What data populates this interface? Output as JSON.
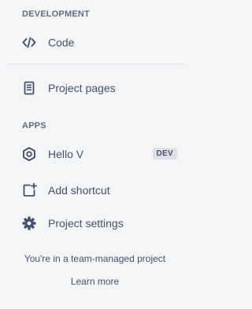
{
  "sections": {
    "development_heading": "DEVELOPMENT",
    "apps_heading": "APPS"
  },
  "nav": {
    "code": "Code",
    "project_pages": "Project pages",
    "hello_v": "Hello V",
    "hello_v_badge": "DEV",
    "add_shortcut": "Add shortcut",
    "project_settings": "Project settings"
  },
  "footer": {
    "note": "You're in a team-managed project",
    "learn_more": "Learn more"
  },
  "icons": {
    "code": "code-icon",
    "project_pages": "page-icon",
    "hello_v": "hexagon-app-icon",
    "add_shortcut": "add-shortcut-icon",
    "project_settings": "gear-icon"
  },
  "colors": {
    "background": "#F4F5F7",
    "text": "#42526E",
    "heading": "#5E6C84",
    "divider": "#DFE1E6",
    "badge_bg": "#DFE1E6"
  }
}
